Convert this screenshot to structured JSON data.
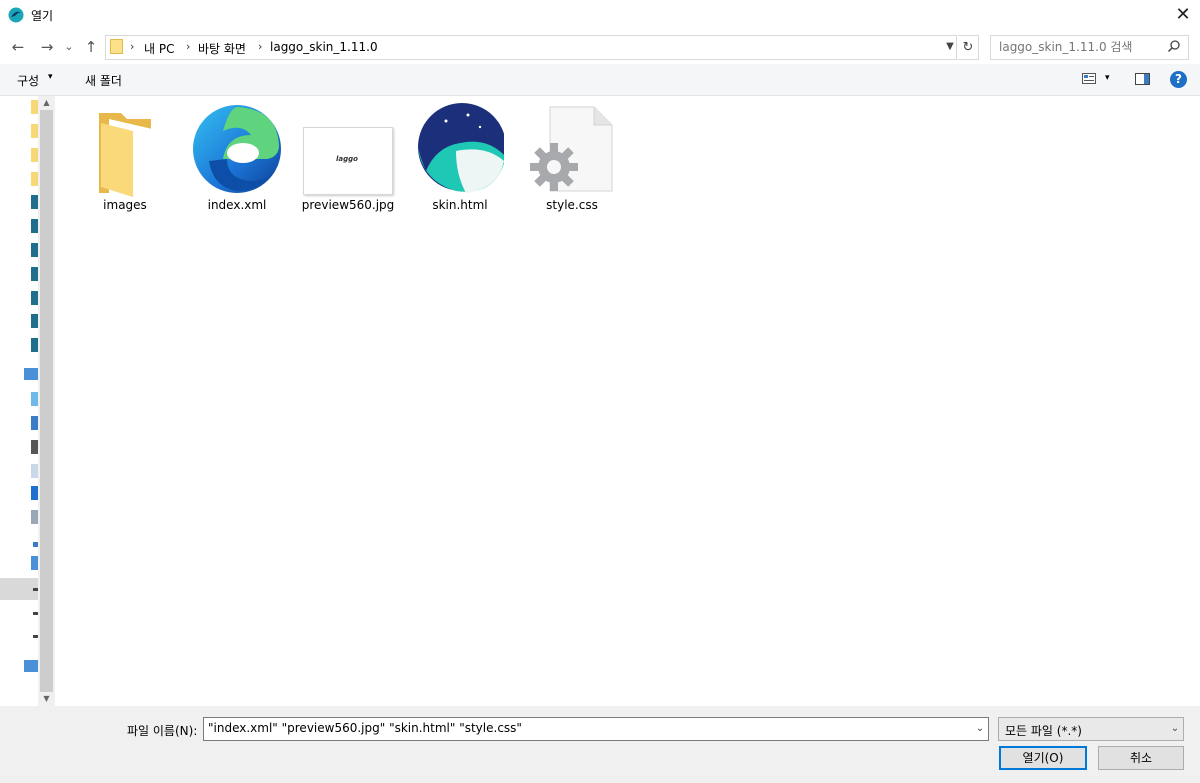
{
  "window": {
    "title": "열기",
    "close_glyph": "✕"
  },
  "nav": {
    "back_glyph": "←",
    "forward_glyph": "→",
    "recent_glyph": "⌄",
    "up_glyph": "↑",
    "breadcrumb": [
      "내 PC",
      "바탕 화면",
      "laggo_skin_1.11.0"
    ],
    "refresh_glyph": "↻",
    "search_placeholder": "laggo_skin_1.11.0 검색"
  },
  "toolbar": {
    "organize_label": "구성",
    "new_folder_label": "새 폴더",
    "caret": "▾",
    "help_label": "?"
  },
  "files": [
    {
      "name": "images",
      "icon": "folder-icon"
    },
    {
      "name": "index.xml",
      "icon": "edge-icon"
    },
    {
      "name": "preview560.jpg",
      "icon": "image-thumbnail",
      "thumb_text": "laggo"
    },
    {
      "name": "skin.html",
      "icon": "whale-browser-icon"
    },
    {
      "name": "style.css",
      "icon": "css-file-icon"
    }
  ],
  "bottom": {
    "filename_label": "파일 이름(N):",
    "filename_value": "\"index.xml\" \"preview560.jpg\" \"skin.html\" \"style.css\"",
    "filetype_value": "모든 파일 (*.*)",
    "open_label": "열기(O)",
    "cancel_label": "취소"
  },
  "colors": {
    "accent": "#0078d7",
    "help": "#1e6fc6",
    "folder": "#f8d775"
  }
}
